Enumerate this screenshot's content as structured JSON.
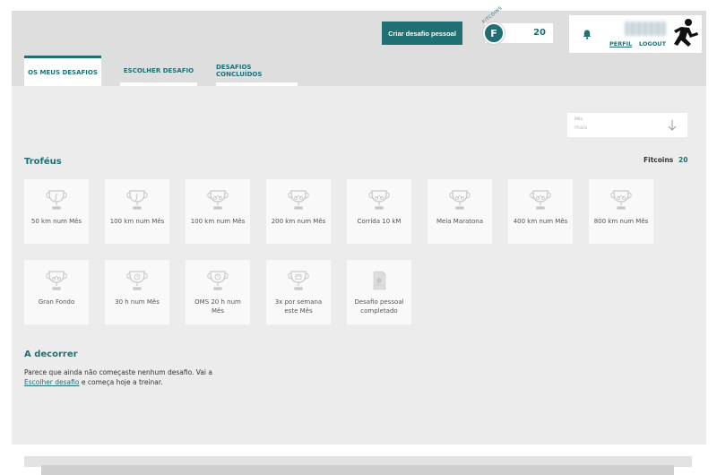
{
  "header": {
    "create_button": "Criar desafio pessoal",
    "fitcoins_arc": "FITCOINS",
    "fitcoins_letter": "F",
    "fitcoins_value": "20",
    "perfil": "PERFIL",
    "logout": "LOGOUT"
  },
  "tabs": [
    {
      "label": "OS MEUS DESAFIOS",
      "active": true
    },
    {
      "label": "ESCOLHER DESAFIO",
      "active": false
    },
    {
      "label": "DESAFIOS CONCLUÍDOS",
      "active": false
    }
  ],
  "filter": {
    "label": "Mês",
    "value": "mais"
  },
  "trophies": {
    "title": "Troféus",
    "fitcoins_label": "Fitcoins",
    "fitcoins_value": "20",
    "items": [
      {
        "label": "50 km num Mês",
        "icon": "trophy-run-icon"
      },
      {
        "label": "100 km num Mês",
        "icon": "trophy-run-icon"
      },
      {
        "label": "100 km num Mês",
        "icon": "trophy-bike-icon"
      },
      {
        "label": "200 km num Mês",
        "icon": "trophy-bike-icon"
      },
      {
        "label": "Corrida 10 kM",
        "icon": "trophy-bike-icon"
      },
      {
        "label": "Meia Maratona",
        "icon": "trophy-bike-icon"
      },
      {
        "label": "400 km num Mês",
        "icon": "trophy-bike-icon"
      },
      {
        "label": "800 km num Mês",
        "icon": "trophy-bike-icon"
      },
      {
        "label": "Gran Fondo",
        "icon": "trophy-bike-icon"
      },
      {
        "label": "30 h num Mês",
        "icon": "trophy-clock-icon"
      },
      {
        "label": "OMS 20 h num Mês",
        "icon": "trophy-clock-icon"
      },
      {
        "label": "3x por semana este Mês",
        "icon": "trophy-calendar-icon"
      },
      {
        "label": "Desafio pessoal completado",
        "icon": "personal-challenge-icon"
      }
    ]
  },
  "ongoing": {
    "title": "A decorrer",
    "text_before": "Parece que ainda não começaste nenhum desafio. Vai a ",
    "link": "Escolher desafio",
    "text_after": " e começa hoje a treinar."
  }
}
